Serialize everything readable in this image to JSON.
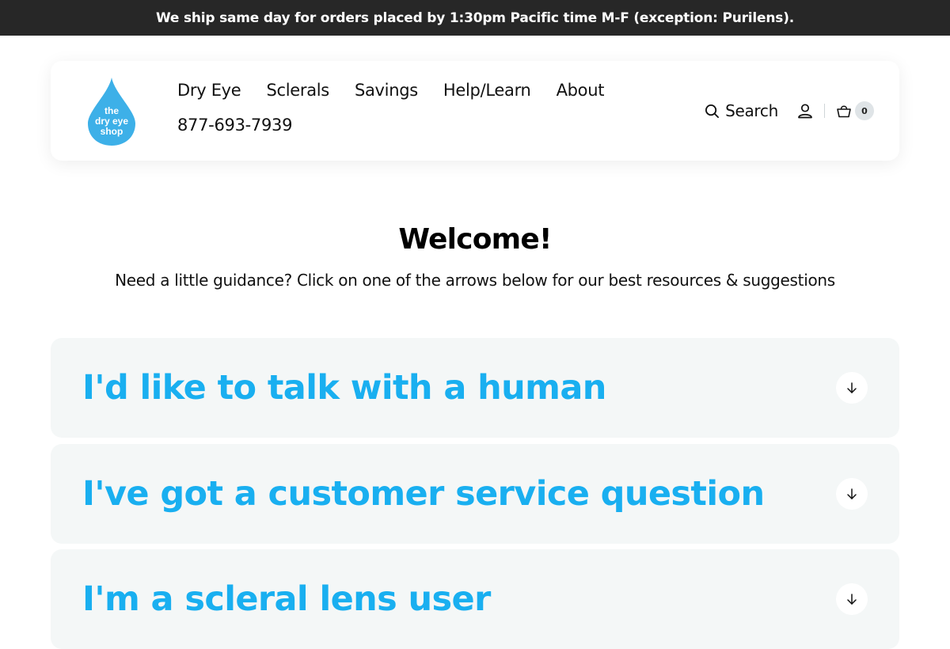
{
  "announcement": "We ship same day for orders placed by 1:30pm Pacific time M-F (exception: Purilens).",
  "header": {
    "logo_text": [
      "the",
      "dry eye",
      "shop"
    ],
    "nav": [
      {
        "label": "Dry Eye"
      },
      {
        "label": "Sclerals"
      },
      {
        "label": "Savings"
      },
      {
        "label": "Help/Learn"
      },
      {
        "label": "About"
      }
    ],
    "phone": "877-693-7939",
    "search_label": "Search",
    "cart_count": "0"
  },
  "hero": {
    "title": "Welcome!",
    "subtitle": "Need a little guidance? Click on one of the arrows below for our best resources & suggestions"
  },
  "accordion": [
    {
      "title": "I'd like to talk with a human"
    },
    {
      "title": "I've got a customer service question"
    },
    {
      "title": "I'm a scleral lens user"
    }
  ],
  "colors": {
    "announcement_bg": "#272727",
    "accent": "#19aff0",
    "logo_blue": "#3db0e8",
    "panel_bg": "#f4f7f7"
  },
  "icons": {
    "search": "search-icon",
    "account": "user-icon",
    "cart": "basket-icon",
    "expand": "arrow-down-icon"
  }
}
